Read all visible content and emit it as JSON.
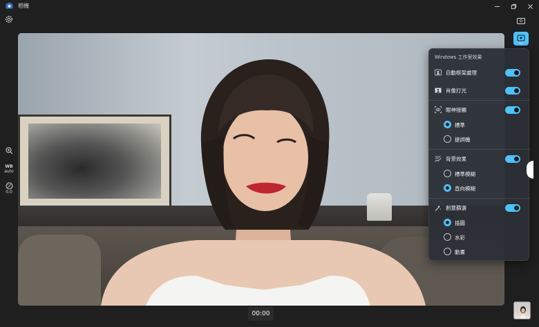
{
  "window": {
    "title": "相機"
  },
  "left_toolbar": {
    "wb_label": "WB",
    "wb_value": "auto",
    "exposure_value": "0.0"
  },
  "panel": {
    "title": "Windows 工作室效果",
    "items": [
      {
        "label": "自動框架處理",
        "icon": "frame-person-icon",
        "enabled": true
      },
      {
        "label": "肖像打光",
        "icon": "portrait-light-icon",
        "enabled": true
      },
      {
        "label": "眼神接觸",
        "icon": "eye-contact-icon",
        "enabled": true,
        "options": [
          {
            "label": "標準",
            "selected": true
          },
          {
            "label": "提詞機",
            "selected": false
          }
        ]
      },
      {
        "label": "背景效果",
        "icon": "background-effects-icon",
        "enabled": true,
        "options": [
          {
            "label": "標準模糊",
            "selected": false
          },
          {
            "label": "直向模糊",
            "selected": true
          }
        ]
      },
      {
        "label": "創意篩選",
        "icon": "creative-filters-icon",
        "enabled": true,
        "options": [
          {
            "label": "插圖",
            "selected": true
          },
          {
            "label": "水彩",
            "selected": false
          },
          {
            "label": "動畫",
            "selected": false
          }
        ]
      }
    ]
  },
  "timer": "00:00",
  "colors": {
    "accent": "#4cc2ff",
    "panel_bg": "#2c3036",
    "window_bg": "#1f1f1f"
  }
}
